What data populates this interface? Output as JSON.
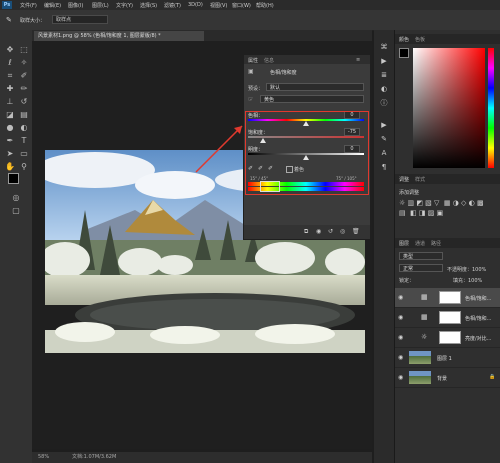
{
  "menu": [
    "文件(F)",
    "编辑(E)",
    "图像(I)",
    "图层(L)",
    "文字(Y)",
    "选择(S)",
    "滤镜(T)",
    "3D(D)",
    "视图(V)",
    "窗口(W)",
    "帮助(H)"
  ],
  "app_logo": "Ps",
  "options": {
    "sample_label": "取样大小：",
    "sample_value": "取样点"
  },
  "document_tab": "风景素材1.png @ 58% (色相/饱和度 1, 图层蒙版/8) *",
  "properties": {
    "tab1": "属性",
    "tab2": "信息",
    "title": "色相/饱和度",
    "preset_label": "预设：",
    "preset_value": "默认",
    "channel_value": "黄色",
    "hue_label": "色相：",
    "hue_value": "0",
    "saturation_label": "饱和度：",
    "saturation_value": "-75",
    "lightness_label": "明度：",
    "lightness_value": "0",
    "colorize_label": "着色",
    "range_left": "15° / 45°",
    "range_right": "75° / 105°",
    "levels": {
      "hue": 0.5,
      "saturation": 0.125,
      "lightness": 0.5
    }
  },
  "status": {
    "zoom": "58%",
    "doc": "文档:1.07M/3.62M"
  },
  "right_panels": {
    "color_tab": "颜色",
    "swatch_tab": "色板",
    "adjust_tab1": "调整",
    "adjust_tab2": "样式",
    "adjust_title": "添加调整",
    "layers_tab": "图层",
    "channels_tab": "通道",
    "paths_tab": "路径",
    "kind": "类型",
    "blend_mode": "正常",
    "opacity": "不透明度：100%",
    "lock": "锁定：",
    "fill": "填充：100%",
    "layers": [
      {
        "name": "色相/饱和...",
        "kind": "adjust"
      },
      {
        "name": "色相/饱和...",
        "kind": "adjust"
      },
      {
        "name": "亮度/对比...",
        "kind": "adjust"
      },
      {
        "name": "图层 1",
        "kind": "image"
      },
      {
        "name": "背景",
        "kind": "image"
      }
    ]
  },
  "icons": [
    "move-icon",
    "marquee-icon",
    "lasso-icon",
    "quick-select-icon",
    "crop-icon",
    "eyedropper-icon",
    "healing-icon",
    "brush-icon",
    "stamp-icon",
    "history-brush-icon",
    "eraser-icon",
    "gradient-icon",
    "blur-icon",
    "dodge-icon",
    "pen-icon",
    "type-icon",
    "path-select-icon",
    "shape-icon",
    "hand-icon",
    "zoom-icon"
  ],
  "colors": {
    "accent": "#e0392e",
    "panel": "#3b3b3b",
    "bg": "#1e1e1e"
  }
}
